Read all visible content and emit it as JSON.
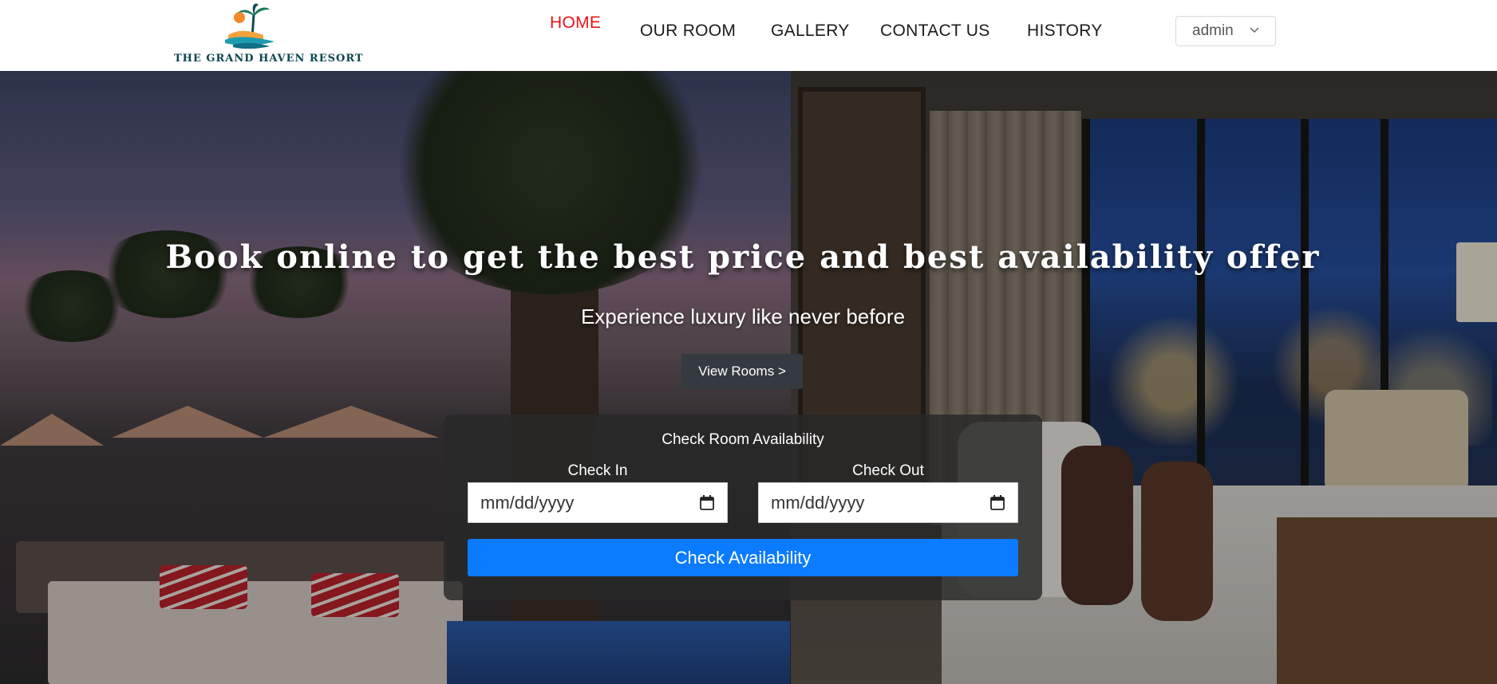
{
  "brand": {
    "name": "THE GRAND HAVEN RESORT",
    "logo_icon": "palm-beach-logo"
  },
  "nav": {
    "items": [
      {
        "label": "HOME",
        "active": true
      },
      {
        "label": "OUR ROOM",
        "active": false
      },
      {
        "label": "GALLERY",
        "active": false
      },
      {
        "label": "CONTACT US",
        "active": false
      },
      {
        "label": "HISTORY",
        "active": false
      }
    ],
    "active_color": "#e8141b"
  },
  "user_menu": {
    "label": "admin",
    "icon": "chevron-down-icon"
  },
  "hero": {
    "title": "Book online to get the best price and best availability offer",
    "subtitle": "Experience luxury like never before",
    "cta_label": "View Rooms >"
  },
  "availability": {
    "title": "Check Room Availability",
    "check_in_label": "Check In",
    "check_in_placeholder": "mm/dd/yyyy",
    "check_out_label": "Check Out",
    "check_out_placeholder": "mm/dd/yyyy",
    "submit_label": "Check Availability",
    "submit_color": "#0b7bff",
    "calendar_icon": "calendar-icon"
  }
}
